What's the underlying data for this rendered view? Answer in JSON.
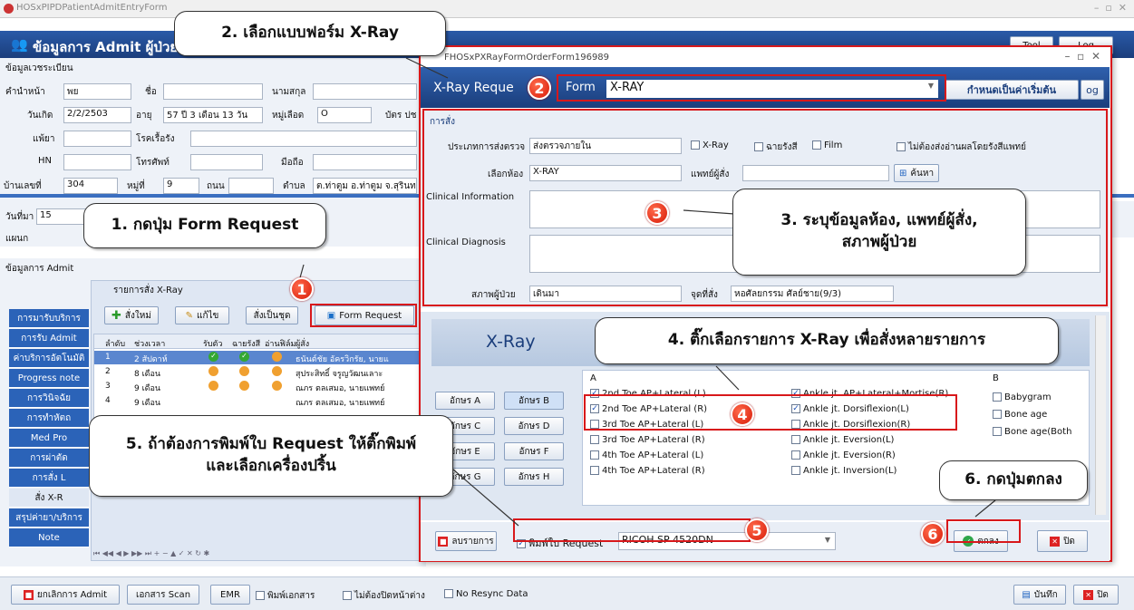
{
  "window": {
    "title": "HOSxPIPDPatientAdmitEntryForm",
    "heading": "ข้อมูลการ Admit ผู้ป่วย",
    "tool_label": "Tool",
    "log_label": "Log"
  },
  "reg": {
    "section": "ข้อมูลเวชระเบียน",
    "prefix_label": "คำนำหน้า",
    "prefix_val": "พย",
    "name_label": "ชื่อ",
    "lname_label": "นามสกุล",
    "dob_label": "วันเกิด",
    "dob_val": "2/2/2503",
    "age_label": "อายุ",
    "age_val": "57 ปี 3 เดือน 13 วัน",
    "blood_label": "หมู่เลือด",
    "blood_val": "O",
    "card_label": "บัตร ปช",
    "allergy_label": "แพ้ยา",
    "chronic_label": "โรคเรื้อรัง",
    "hn_label": "HN",
    "phone_label": "โทรศัพท์",
    "mobile_label": "มือถือ",
    "house_label": "บ้านเลขที่",
    "house_val": "304",
    "moo_label": "หมู่ที่",
    "moo_val": "9",
    "road_label": "ถนน",
    "tambon_label": "ตำบล",
    "tambon_val": "ต.ท่าตูม อ.ท่าตูม จ.สุรินทร์",
    "admit_date_label": "วันที่มา",
    "admit_date_val": "15",
    "ward_label": "แผนก"
  },
  "admit": {
    "section": "ข้อมูลการ Admit",
    "xray_orders_label": "รายการสั่ง X-Ray",
    "new_btn": "สั่งใหม่",
    "edit_btn": "แก้ไข",
    "set_btn": "สั่งเป็นชุด",
    "form_btn": "Form Request",
    "cols": [
      "ลำดับ",
      "ช่วงเวลา",
      "รับตัว",
      "ฉายรังสี",
      "อ่านฟิล์ม",
      "ผู้สั่ง"
    ],
    "rows": [
      {
        "no": "1",
        "time": "2 สัปดาห์",
        "doc": "ธนันต์ชัย อัครวิกรัย, นายแ"
      },
      {
        "no": "2",
        "time": "8 เดือน",
        "doc": "สุประสิทธิ์ จรูญวัฒนเลาะ"
      },
      {
        "no": "3",
        "time": "9 เดือน",
        "doc": "ณภร ตลเสมอ, นายแพทย์"
      },
      {
        "no": "4",
        "time": "9 เดือน",
        "doc": "ณภร ตลเสมอ, นายแพทย์"
      }
    ],
    "tabs": [
      "การมารับบริการ",
      "การรับ Admit",
      "ค่าบริการอัตโนมัติ",
      "Progress note",
      "การวินิจฉัย",
      "การทำหัตถ",
      "Med Pro",
      "การผ่าตัด",
      "การสั่ง L",
      "สั่ง X-R",
      "สรุปค่ายา/บริการ",
      "Note"
    ]
  },
  "dialog": {
    "title": "FHOSxPXRayFormOrderForm196989",
    "header": "X-Ray Reque",
    "form_label": "Form",
    "form_val": "X-RAY",
    "default_btn": "กำหนดเป็นค่าเริ่มต้น",
    "section": "การสั่ง",
    "send_type_label": "ประเภทการส่งตรวจ",
    "send_type_val": "ส่งตรวจภายใน",
    "xray_chk": "X-Ray",
    "radiology_chk": "ฉายรังสี",
    "film_chk": "Film",
    "no_read_chk": "ไม่ต้องส่งอ่านผลโดยรังสีแพทย์",
    "room_label": "เลือกห้อง",
    "room_val": "X-RAY",
    "doctor_label": "แพทย์ผู้สั่ง",
    "search_btn": "ค้นหา",
    "clinical_info_label": "Clinical Information",
    "clinical_dx_label": "Clinical Diagnosis",
    "status_label": "สภาพผู้ป่วย",
    "status_val": "เดินมา",
    "order_point_label": "จุดที่สั่ง",
    "order_point_val": "หอศัลยกรรม ศัลย์ชาย(9/3)",
    "xray_title": "X-Ray",
    "alpha_buttons": [
      "อักษร A",
      "อักษร B",
      "อักษร C",
      "อักษร D",
      "อักษร E",
      "อักษร F",
      "อักษร G",
      "อักษร H"
    ],
    "col_a": "A",
    "col_b": "B",
    "list_a1": [
      {
        "t": "2nd Toe AP+Lateral (L)",
        "c": true
      },
      {
        "t": "2nd Toe AP+Lateral (R)",
        "c": true
      },
      {
        "t": "3rd Toe AP+Lateral (L)",
        "c": false
      },
      {
        "t": "3rd Toe AP+Lateral (R)",
        "c": false
      },
      {
        "t": "4th Toe AP+Lateral (L)",
        "c": false
      },
      {
        "t": "4th Toe AP+Lateral (R)",
        "c": false
      }
    ],
    "list_a2": [
      {
        "t": "Ankle jt. AP+Lateral+Mortise(R)",
        "c": true
      },
      {
        "t": "Ankle jt. Dorsiflexion(L)",
        "c": true
      },
      {
        "t": "Ankle jt. Dorsiflexion(R)",
        "c": false
      },
      {
        "t": "Ankle jt. Eversion(L)",
        "c": false
      },
      {
        "t": "Ankle jt. Eversion(R)",
        "c": false
      },
      {
        "t": "Ankle jt. Inversion(L)",
        "c": false
      }
    ],
    "list_b": [
      {
        "t": "Babygram",
        "c": false
      },
      {
        "t": "Bone age",
        "c": false
      },
      {
        "t": "Bone age(Both",
        "c": false
      }
    ],
    "delete_btn": "ลบรายการ",
    "print_chk": "พิมพ์ใบ Request",
    "printer_val": "RICOH SP 4520DN",
    "ok_btn": "ตกลง",
    "close_btn": "ปิด"
  },
  "footer": {
    "cancel_btn": "ยกเลิกการ Admit",
    "scan_btn": "เอกสาร Scan",
    "emr_btn": "EMR",
    "print_doc_chk": "พิมพ์เอกสาร",
    "no_close_chk": "ไม่ต้องปิดหน้าต่าง",
    "no_resync_chk": "No Resync Data",
    "save_btn": "บันทึก",
    "close_btn": "ปิด"
  },
  "callouts": {
    "c1": "1. กดปุ่ม Form Request",
    "c2": "2. เลือกแบบฟอร์ม X-Ray",
    "c3a": "3. ระบุข้อมูลห้อง, แพทย์ผู้สั่ง,",
    "c3b": "สภาพผู้ป่วย",
    "c4": "4. ติ๊กเลือกรายการ X-Ray เพื่อสั่งหลายรายการ",
    "c5a": "5. ถ้าต้องการพิมพ์ใบ Request ให้ติ๊กพิมพ์",
    "c5b": "และเลือกเครื่องปริ้น",
    "c6": "6. กดปุ่มตกลง"
  },
  "badges": [
    "1",
    "2",
    "3",
    "4",
    "5",
    "6"
  ]
}
